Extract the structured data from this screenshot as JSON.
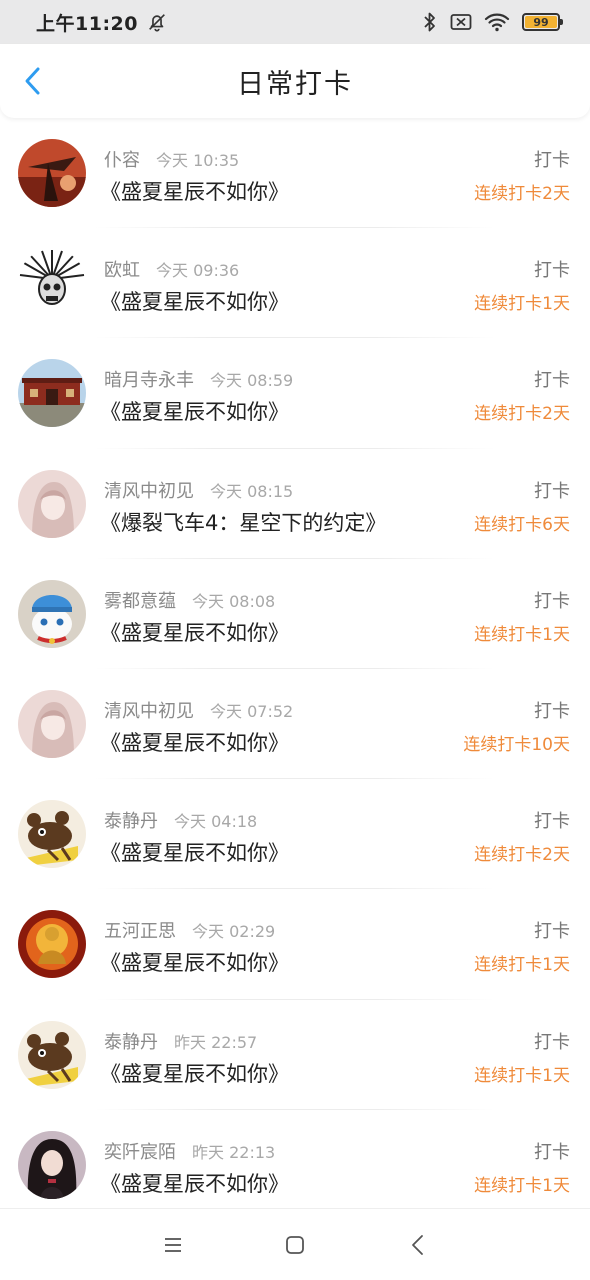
{
  "status_bar": {
    "time": "上午11:20",
    "icons": [
      "mute-bell-icon",
      "bluetooth-icon",
      "sim-off-icon",
      "wifi-icon",
      "battery-icon"
    ],
    "battery_level": "99",
    "battery_fraction": 0.99,
    "battery_color": "#f2b232"
  },
  "header": {
    "title": "日常打卡",
    "back_icon": "chevron-left-icon",
    "accent": "#2e9cf0"
  },
  "colors": {
    "streak": "#ef8a3a"
  },
  "checkins": [
    {
      "username": "仆容",
      "time": "今天 10:35",
      "book": "《盛夏星辰不如你》",
      "action": "打卡",
      "streak": "连续打卡2天"
    },
    {
      "username": "欧虹",
      "time": "今天 09:36",
      "book": "《盛夏星辰不如你》",
      "action": "打卡",
      "streak": "连续打卡1天"
    },
    {
      "username": "暗月寺永丰",
      "time": "今天 08:59",
      "book": "《盛夏星辰不如你》",
      "action": "打卡",
      "streak": "连续打卡2天"
    },
    {
      "username": "清风中初见",
      "time": "今天 08:15",
      "book": "《爆裂飞车4：星空下的约定》",
      "action": "打卡",
      "streak": "连续打卡6天"
    },
    {
      "username": "雾都意蕴",
      "time": "今天 08:08",
      "book": "《盛夏星辰不如你》",
      "action": "打卡",
      "streak": "连续打卡1天"
    },
    {
      "username": "清风中初见",
      "time": "今天 07:52",
      "book": "《盛夏星辰不如你》",
      "action": "打卡",
      "streak": "连续打卡10天"
    },
    {
      "username": "泰静丹",
      "time": "今天 04:18",
      "book": "《盛夏星辰不如你》",
      "action": "打卡",
      "streak": "连续打卡2天"
    },
    {
      "username": "五河正思",
      "time": "今天 02:29",
      "book": "《盛夏星辰不如你》",
      "action": "打卡",
      "streak": "连续打卡1天"
    },
    {
      "username": "泰静丹",
      "time": "昨天 22:57",
      "book": "《盛夏星辰不如你》",
      "action": "打卡",
      "streak": "连续打卡1天"
    },
    {
      "username": "奕阡宸陌",
      "time": "昨天 22:13",
      "book": "《盛夏星辰不如你》",
      "action": "打卡",
      "streak": "连续打卡1天"
    }
  ],
  "nav_bar": {
    "icons": [
      "menu-icon",
      "home-square-icon",
      "back-triangle-icon"
    ]
  }
}
